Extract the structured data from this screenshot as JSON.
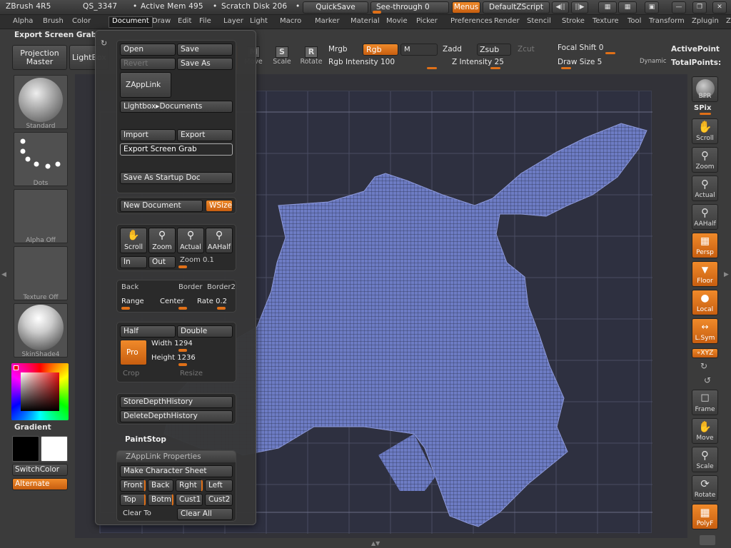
{
  "titlebar": {
    "app": "ZBrush 4R5",
    "qs": "QS_3347",
    "dot1": "•",
    "active_mem": "Active Mem 495",
    "dot2": "•",
    "scratch": "Scratch Disk 206",
    "dot3": "•",
    "quicksave": "QuickSave",
    "seethrough": "See-through  0",
    "menus": "Menus",
    "script": "DefaultZScript"
  },
  "menubar": {
    "items": [
      "Alpha",
      "Brush",
      "Color",
      "Document",
      "Draw",
      "Edit",
      "File",
      "Layer",
      "Light",
      "Macro",
      "Marker",
      "Material",
      "Movie",
      "Picker",
      "Preferences",
      "Render",
      "Stencil",
      "Stroke",
      "Texture",
      "Tool",
      "Transform",
      "Zplugin",
      "Zscript"
    ]
  },
  "toolbar": {
    "export_label": "Export Screen Grab",
    "projection_master": "Projection Master",
    "lightbox": "LightBox",
    "move": "Move",
    "scale": "Scale",
    "rotate": "Rotate",
    "move_icon_letter": "M",
    "scale_icon_letter": "S",
    "rotate_icon_letter": "R",
    "mrgb": "Mrgb",
    "rgb": "Rgb",
    "m": "M",
    "zadd": "Zadd",
    "zsub": "Zsub",
    "zcut": "Zcut",
    "rgb_intensity": "Rgb Intensity 100",
    "z_intensity": "Z Intensity 25",
    "focal_shift": "Focal Shift 0",
    "draw_size": "Draw Size 5",
    "dynamic": "Dynamic",
    "active_points": "ActivePoint",
    "total_points": "TotalPoints:"
  },
  "left_shelf": {
    "standard": "Standard",
    "dots": "Dots",
    "alpha_off": "Alpha  Off",
    "texture_off": "Texture  Off",
    "skinshade": "SkinShade4",
    "gradient": "Gradient",
    "switch_color": "SwitchColor",
    "alternate": "Alternate"
  },
  "right_shelf": {
    "bpr": "BPR",
    "spix": "SPix",
    "scroll": "Scroll",
    "zoom": "Zoom",
    "actual": "Actual",
    "aahalf": "AAHalf",
    "persp": "Persp",
    "floor": "Floor",
    "local": "Local",
    "lsym": "L.Sym",
    "xyz": "∘XYZ",
    "frame": "Frame",
    "move": "Move",
    "scale": "Scale",
    "rotate": "Rotate",
    "polyf": "PolyF"
  },
  "popup": {
    "open": "Open",
    "save": "Save",
    "revert": "Revert",
    "save_as": "Save As",
    "zapplink": "ZAppLink",
    "lightbox_docs": "Lightbox▸Documents",
    "import": "Import",
    "export": "Export",
    "export_screen_grab": "Export Screen Grab",
    "save_startup": "Save As Startup Doc",
    "new_document": "New Document",
    "wsize": "WSize",
    "scroll": "Scroll",
    "zoom": "Zoom",
    "actual": "Actual",
    "aahalf": "AAHalf",
    "in": "In",
    "out": "Out",
    "zoom_val": "Zoom 0.1",
    "back": "Back",
    "border": "Border",
    "border2": "Border2",
    "range": "Range",
    "center": "Center",
    "rate": "Rate 0.2",
    "half": "Half",
    "double": "Double",
    "pro": "Pro",
    "width": "Width 1294",
    "height": "Height 1236",
    "crop": "Crop",
    "resize": "Resize",
    "store_depth": "StoreDepthHistory",
    "delete_depth": "DeleteDepthHistory",
    "paintstop": "PaintStop",
    "zapplink_props": "ZAppLink Properties",
    "make_char_sheet": "Make Character Sheet",
    "front": "Front",
    "back_v": "Back",
    "right": "Rght",
    "left": "Left",
    "top": "Top",
    "bottom": "Botm",
    "cust1": "Cust1",
    "cust2": "Cust2",
    "clear_to": "Clear To",
    "clear_all": "Clear All"
  },
  "colors": {
    "accent": "#e07018",
    "mesh": "#6f7fc8",
    "canvas": "#2e3040"
  }
}
